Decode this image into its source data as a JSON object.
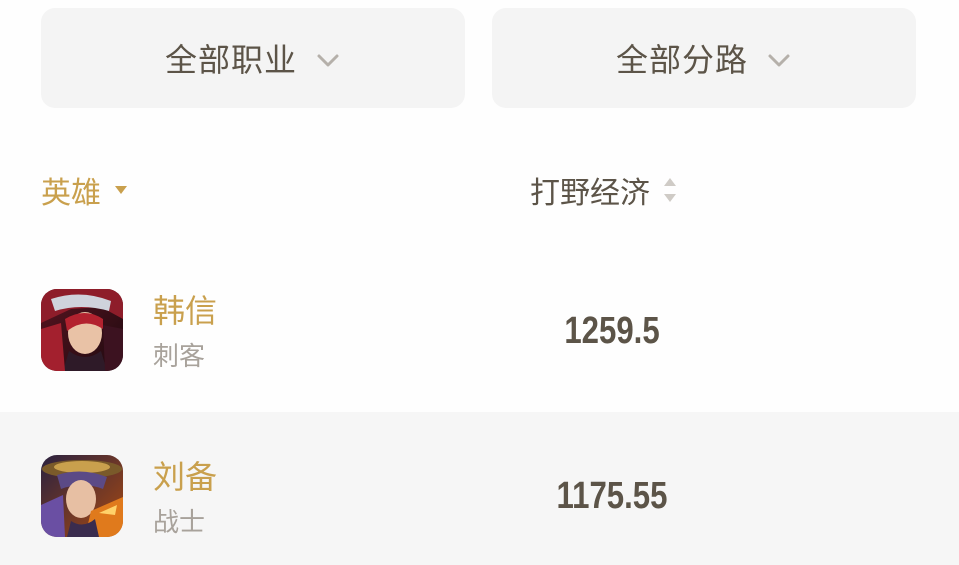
{
  "filters": {
    "role": {
      "label": "全部职业"
    },
    "lane": {
      "label": "全部分路"
    }
  },
  "table": {
    "headers": {
      "hero": "英雄",
      "jungle_economy": "打野经济"
    },
    "rows": [
      {
        "name": "韩信",
        "class": "刺客",
        "value": "1259.5",
        "avatar": "hanxin-portrait"
      },
      {
        "name": "刘备",
        "class": "战士",
        "value": "1175.55",
        "avatar": "liubei-portrait"
      }
    ]
  },
  "colors": {
    "accent_gold": "#c9a04d",
    "text_dark": "#5c5448",
    "text_muted": "#a8a29b",
    "filter_bg": "#f4f4f4"
  }
}
